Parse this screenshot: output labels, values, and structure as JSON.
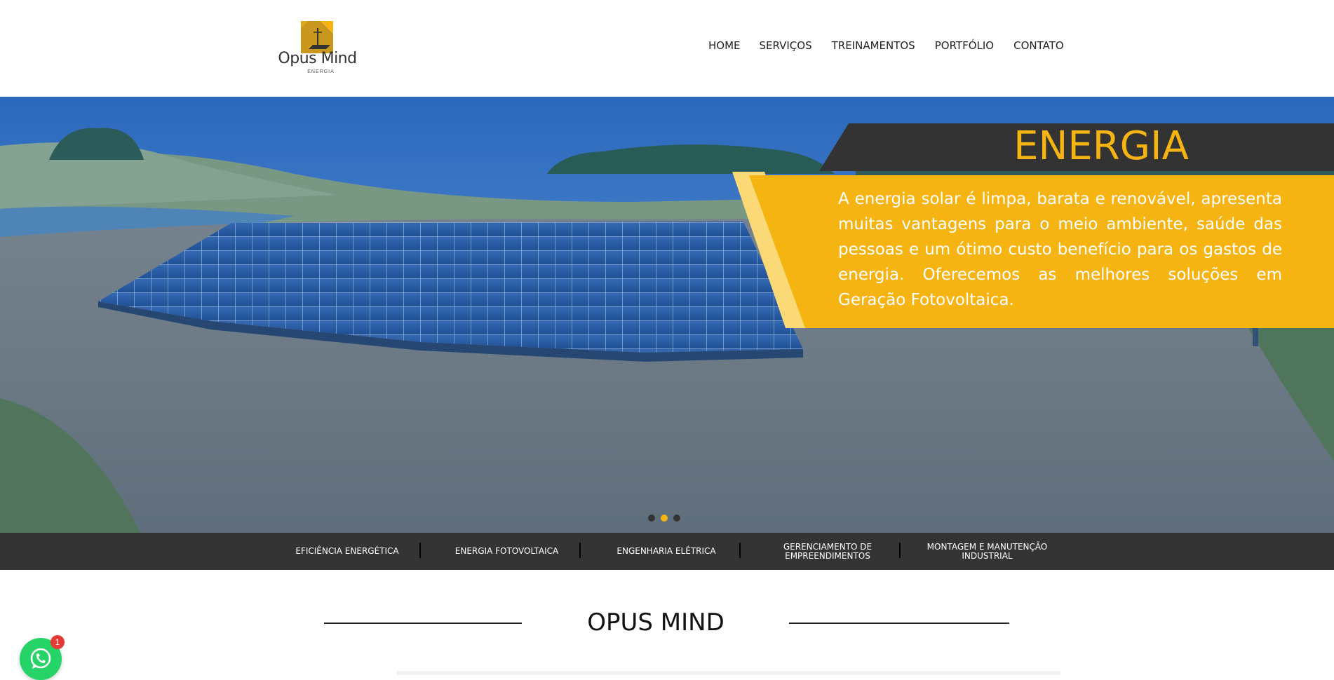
{
  "brand": {
    "name": "Opus Mind",
    "tagline": "ENERGIA"
  },
  "nav": {
    "items": [
      {
        "label": "HOME",
        "active": true
      },
      {
        "label": "SERVIÇOS"
      },
      {
        "label": "TREINAMENTOS"
      },
      {
        "label": "PORTFÓLIO"
      },
      {
        "label": "CONTATO"
      }
    ]
  },
  "hero": {
    "heading": "ENERGIA",
    "text": "A energia solar é limpa, barata e renovável, apresenta muitas vantagens para o meio ambiente, saúde das pessoas e um ótimo custo benefício para os gastos de energia. Oferecemos as melhores soluções em Geração Fotovoltaica.",
    "slides": 3,
    "active_slide": 2
  },
  "services": [
    "EFICIÊNCIA ENERGÉTICA",
    "ENERGIA FOTOVOLTAICA",
    "ENGENHARIA ELÉTRICA",
    "GERENCIAMENTO DE EMPREENDIMENTOS",
    "MONTAGEM E MANUTENÇÃO INDUSTRIAL"
  ],
  "about": {
    "title": "OPUS MIND"
  },
  "whatsapp": {
    "badge": "1"
  },
  "colors": {
    "accent": "#f6b412",
    "dark": "#343434",
    "sky": "#3f7fc6",
    "whatsapp": "#25d366"
  },
  "icons": {
    "logo": "solar-house-logo-icon",
    "whatsapp": "whatsapp-icon"
  }
}
